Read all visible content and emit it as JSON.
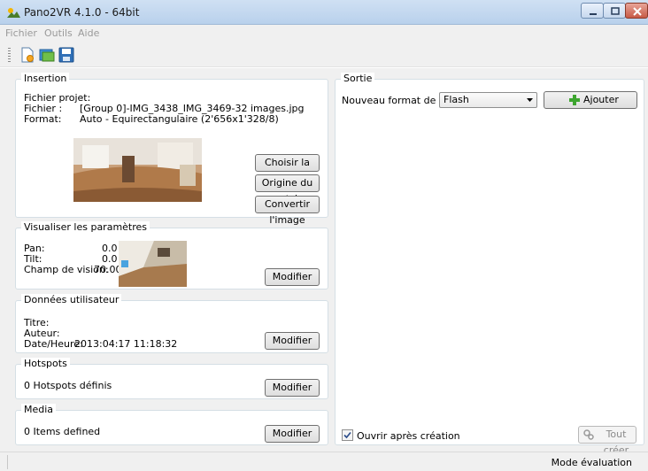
{
  "window": {
    "title": "Pano2VR 4.1.0 - 64bit"
  },
  "menu": {
    "items": [
      "Fichier",
      "Outils",
      "Aide"
    ]
  },
  "toolbar": {
    "icons": [
      "new-project-icon",
      "open-project-icon",
      "save-project-icon"
    ]
  },
  "insertion": {
    "title": "Insertion",
    "project_label": "Fichier projet:",
    "project_value": "-",
    "file_label": "Fichier :",
    "file_value": "[Group 0]-IMG_3438_IMG_3469-32 images.jpg",
    "format_label": "Format:",
    "format_value": "Auto - Equirectangulaire (2'656x1'328/8)",
    "btn_source": "Choisir la source",
    "btn_patch": "Origine du patch",
    "btn_convert": "Convertir l'image"
  },
  "view": {
    "title": "Visualiser les paramètres",
    "pan_label": "Pan:",
    "pan_value": "0.0",
    "tilt_label": "Tilt:",
    "tilt_value": "0.0",
    "fov_label": "Champ de vision:",
    "fov_value": "70.00",
    "btn_modify": "Modifier"
  },
  "userdata": {
    "title": "Données utilisateur",
    "title_label": "Titre:",
    "author_label": "Auteur:",
    "date_label": "Date/Heure:",
    "date_value": "2013:04:17 11:18:32",
    "btn_modify": "Modifier"
  },
  "hotspots": {
    "title": "Hotspots",
    "summary": "0 Hotspots définis",
    "btn_modify": "Modifier"
  },
  "media": {
    "title": "Media",
    "summary": "0 Items defined",
    "btn_modify": "Modifier"
  },
  "output": {
    "title": "Sortie",
    "format_label": "Nouveau format de sortie:",
    "format_selected": "Flash",
    "btn_add": "Ajouter",
    "open_after_label": "Ouvrir après création",
    "open_after_checked": true,
    "btn_create_all": "Tout créer"
  },
  "status": {
    "mode": "Mode évaluation"
  }
}
